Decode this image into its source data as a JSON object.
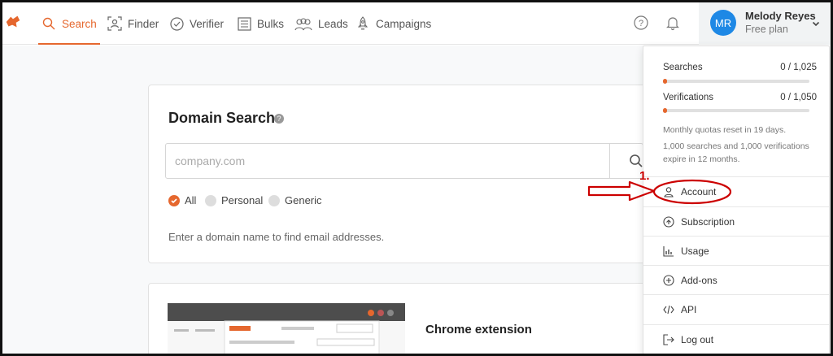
{
  "nav": {
    "items": [
      {
        "label": "Search",
        "icon": "search-icon",
        "active": true
      },
      {
        "label": "Finder",
        "icon": "finder-icon"
      },
      {
        "label": "Verifier",
        "icon": "verifier-icon"
      },
      {
        "label": "Bulks",
        "icon": "bulks-icon"
      },
      {
        "label": "Leads",
        "icon": "leads-icon"
      },
      {
        "label": "Campaigns",
        "icon": "campaigns-icon"
      }
    ]
  },
  "user": {
    "initials": "MR",
    "name": "Melody Reyes",
    "plan": "Free plan"
  },
  "domain_search": {
    "title": "Domain Search",
    "placeholder": "company.com",
    "filters": [
      {
        "label": "All",
        "checked": true
      },
      {
        "label": "Personal",
        "checked": false
      },
      {
        "label": "Generic",
        "checked": false
      }
    ],
    "hint": "Enter a domain name to find email addresses."
  },
  "chrome_extension": {
    "title": "Chrome extension",
    "subtitle": ""
  },
  "dropdown": {
    "quotas": [
      {
        "label": "Searches",
        "value": "0 / 1,025",
        "fraction": 0.0
      },
      {
        "label": "Verifications",
        "value": "0 / 1,050",
        "fraction": 0.0
      }
    ],
    "note_1": "Monthly quotas reset in 19 days.",
    "note_2": "1,000 searches and 1,000 verifications expire in 12 months.",
    "menu": [
      {
        "label": "Account",
        "icon": "user-icon"
      },
      {
        "label": "Subscription",
        "icon": "subscription-icon"
      },
      {
        "label": "Usage",
        "icon": "usage-chart-icon"
      },
      {
        "label": "Add-ons",
        "icon": "add-icon"
      },
      {
        "label": "API",
        "icon": "code-icon"
      },
      {
        "label": "Log out",
        "icon": "logout-icon"
      }
    ]
  },
  "annotation": {
    "step": "1.",
    "color": "#cc0000"
  },
  "colors": {
    "accent": "#e5672e",
    "avatar": "#1e88e5"
  }
}
